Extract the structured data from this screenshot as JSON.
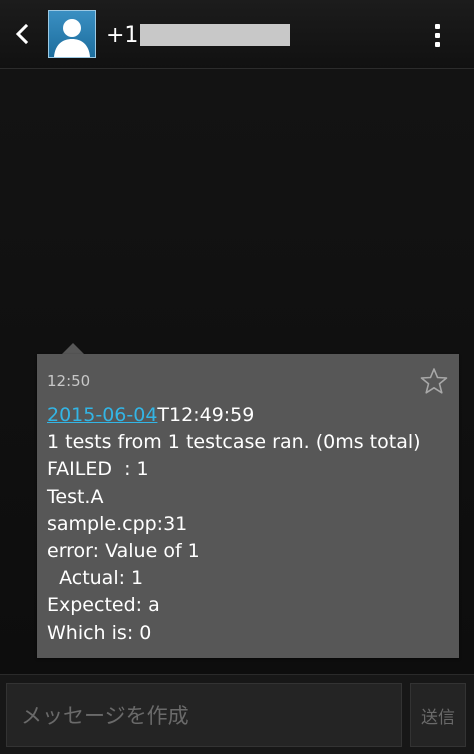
{
  "header": {
    "contact_prefix": "+1",
    "back_icon": "chevron-left-icon",
    "menu_icon": "overflow-menu-icon",
    "avatar_icon": "person-silhouette-icon"
  },
  "message": {
    "time": "12:50",
    "date_link": "2015-06-04",
    "lines": [
      "T12:49:59",
      "1 tests from 1 testcase ran. (0ms total)",
      "FAILED  : 1",
      "Test.A",
      "sample.cpp:31",
      "error: Value of 1",
      "  Actual: 1",
      "Expected: a",
      "Which is: 0"
    ],
    "star_icon": "star-outline-icon"
  },
  "composer": {
    "placeholder": "メッセージを作成",
    "send_label": "送信"
  },
  "colors": {
    "link": "#33b5e5",
    "bubble": "#575757",
    "background": "#101010"
  }
}
